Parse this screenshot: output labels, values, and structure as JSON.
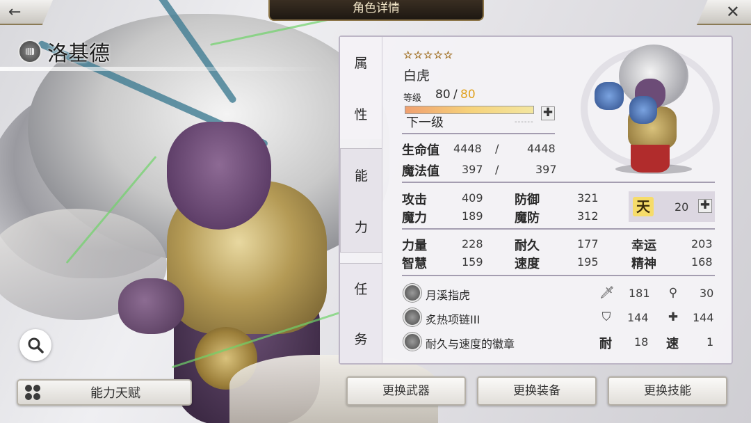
{
  "header": {
    "title": "角色详情",
    "back_icon": "←",
    "close_icon": "✕"
  },
  "character": {
    "name": "洛基德",
    "class_icon": "fist-icon",
    "rarity_stars": "☆☆☆☆☆",
    "class_name": "白虎"
  },
  "tabs": {
    "attributes": [
      "属",
      "性"
    ],
    "ability": [
      "能",
      "力"
    ],
    "task": [
      "任",
      "务"
    ]
  },
  "level": {
    "label": "等级",
    "current": "80",
    "separator": "/",
    "max": "80",
    "next_label": "下一级",
    "exp_fraction": 1.0,
    "plus": "✚"
  },
  "vitals": [
    {
      "label": "生命值",
      "current": "4448",
      "sep": "/",
      "max": "4448"
    },
    {
      "label": "魔法值",
      "current": "397",
      "sep": "/",
      "max": "397"
    }
  ],
  "combat": [
    {
      "label": "攻击",
      "value": "409"
    },
    {
      "label": "防御",
      "value": "321"
    },
    {
      "label": "魔力",
      "value": "189"
    },
    {
      "label": "魔防",
      "value": "312"
    }
  ],
  "tian": {
    "icon": "天",
    "value": "20",
    "plus": "✚"
  },
  "base_stats": [
    {
      "label": "力量",
      "value": "228"
    },
    {
      "label": "耐久",
      "value": "177"
    },
    {
      "label": "幸运",
      "value": "203"
    },
    {
      "label": "智慧",
      "value": "159"
    },
    {
      "label": "速度",
      "value": "195"
    },
    {
      "label": "精神",
      "value": "168"
    }
  ],
  "equipment": [
    {
      "name": "月溪指虎",
      "stat1_icon": "🗡",
      "stat1": "181",
      "stat2_icon": "⚲",
      "stat2": "30"
    },
    {
      "name": "炙热项链III",
      "stat1_icon": "⛉",
      "stat1": "144",
      "stat2_icon": "✚",
      "stat2": "144"
    },
    {
      "name": "耐久与速度的徽章",
      "stat1_label": "耐",
      "stat1": "18",
      "stat2_label": "速",
      "stat2": "1"
    }
  ],
  "buttons": {
    "talent": "能力天赋",
    "change_weapon": "更换武器",
    "change_equipment": "更换装备",
    "change_skill": "更换技能"
  }
}
